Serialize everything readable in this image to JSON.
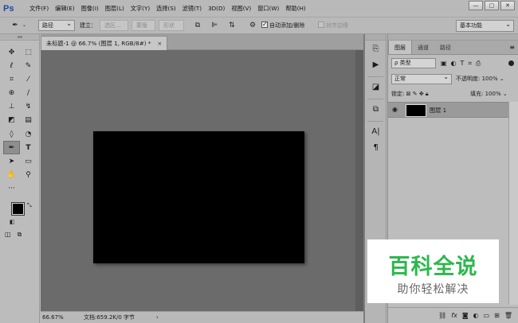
{
  "app": {
    "logo": "Ps"
  },
  "menu": [
    "文件(F)",
    "编辑(E)",
    "图像(I)",
    "图层(L)",
    "文字(Y)",
    "选择(S)",
    "滤镜(T)",
    "3D(D)",
    "视图(V)",
    "窗口(W)",
    "帮助(H)"
  ],
  "window_controls": {
    "minimize": "—",
    "restore": "▢",
    "close": "✕"
  },
  "options_bar": {
    "mode_select": "路径",
    "build_label": "建立：",
    "selection_btn": "选区...",
    "mask_btn": "蒙版",
    "shape_btn": "形状",
    "auto_add_delete": "自动添加/删除",
    "auto_add_delete_checked": true,
    "align_edges": "对齐边缘",
    "align_edges_checked": false
  },
  "workspace": "基本功能",
  "document": {
    "tab_title": "未标题-1 @ 66.7% (图层 1, RGB/8#) *",
    "close": "×",
    "canvas_color": "#000000",
    "zoom": "66.67%",
    "doc_info": "文档:659.2K/0 字节",
    "status_arrow": "›"
  },
  "tools": [
    [
      "move-tool",
      "rect-marquee-tool"
    ],
    [
      "lasso-tool",
      "quick-select-tool"
    ],
    [
      "crop-tool",
      "eyedropper-tool"
    ],
    [
      "healing-brush-tool",
      "brush-tool"
    ],
    [
      "clone-stamp-tool",
      "history-brush-tool"
    ],
    [
      "eraser-tool",
      "gradient-tool"
    ],
    [
      "blur-tool",
      "dodge-tool"
    ],
    [
      "pen-tool",
      "type-tool"
    ],
    [
      "path-select-tool",
      "rect-shape-tool"
    ],
    [
      "hand-tool",
      "zoom-tool"
    ],
    [
      "more-tools"
    ]
  ],
  "colors": {
    "foreground": "#000000",
    "background": "#ffffff"
  },
  "layers_panel": {
    "tabs": [
      "图层",
      "通道",
      "路径"
    ],
    "active_tab": "图层",
    "filter_label": "ρ 类型",
    "blend_mode": "正常",
    "opacity_label": "不透明度:",
    "opacity_value": "100%",
    "lock_label": "锁定:",
    "fill_label": "填充:",
    "fill_value": "100%",
    "layers": [
      {
        "name": "图层 1",
        "visible": true,
        "selected": true
      }
    ],
    "bottom_icons": [
      "link-icon",
      "fx-icon",
      "mask-icon",
      "adjustment-icon",
      "group-icon",
      "new-layer-icon",
      "trash-icon"
    ]
  },
  "watermark": {
    "title": "百科全说",
    "subtitle": "助你轻松解决",
    "color": "#2db84d"
  }
}
